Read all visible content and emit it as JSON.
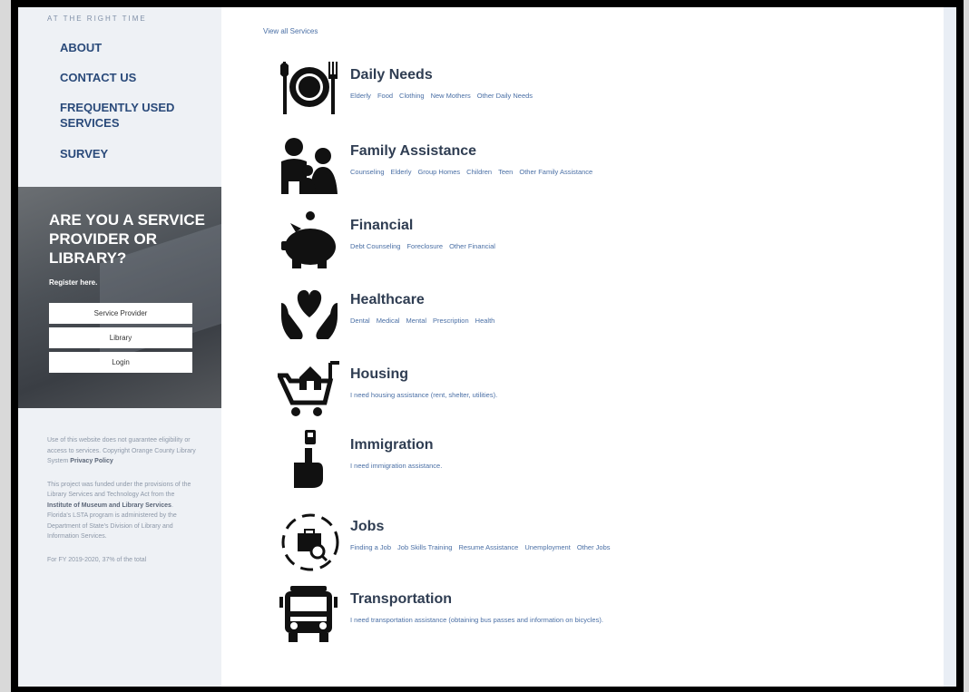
{
  "sidebar": {
    "tagline": "AT THE RIGHT TIME",
    "nav": [
      "ABOUT",
      "CONTACT US",
      "FREQUENTLY USED SERVICES",
      "SURVEY"
    ],
    "promo": {
      "title": "ARE YOU A SERVICE PROVIDER OR LIBRARY?",
      "subtitle": "Register here.",
      "buttons": [
        "Service Provider",
        "Library",
        "Login"
      ]
    },
    "footer": {
      "p1_text": "Use of this website does not guarantee eligibility or access to services. Copyright Orange County Library System ",
      "p1_link": "Privacy Policy",
      "p2_text1": "This project was funded under the provisions of the Library Services and Technology Act from the ",
      "p2_link": "Institute of Museum and Library Services",
      "p2_text2": ". Florida's LSTA program is administered by the Department of State's Division of Library and Information Services.",
      "p3_text": "For FY 2019-2020, 37% of the total"
    }
  },
  "main": {
    "view_all": "View all Services",
    "services": [
      {
        "title": "Daily Needs",
        "icon": "plate-utensils-icon",
        "links": [
          "Elderly",
          "Food",
          "Clothing",
          "New Mothers",
          "Other Daily Needs"
        ]
      },
      {
        "title": "Family Assistance",
        "icon": "family-icon",
        "links": [
          "Counseling",
          "Elderly",
          "Group Homes",
          "Children",
          "Teen",
          "Other Family Assistance"
        ]
      },
      {
        "title": "Financial",
        "icon": "piggy-bank-icon",
        "links": [
          "Debt Counseling",
          "Foreclosure",
          "Other Financial"
        ]
      },
      {
        "title": "Healthcare",
        "icon": "heart-hands-icon",
        "links": [
          "Dental",
          "Medical",
          "Mental",
          "Prescription",
          "Health"
        ]
      },
      {
        "title": "Housing",
        "icon": "house-cart-icon",
        "links": [
          "I need housing assistance (rent, shelter, utilities)."
        ]
      },
      {
        "title": "Immigration",
        "icon": "hand-passport-icon",
        "links": [
          "I need immigration assistance."
        ]
      },
      {
        "title": "Jobs",
        "icon": "briefcase-search-icon",
        "links": [
          "Finding a Job",
          "Job Skills Training",
          "Resume Assistance",
          "Unemployment",
          "Other Jobs"
        ]
      },
      {
        "title": "Transportation",
        "icon": "bus-icon",
        "links": [
          "I need transportation assistance (obtaining bus passes and information on bicycles)."
        ]
      }
    ]
  }
}
